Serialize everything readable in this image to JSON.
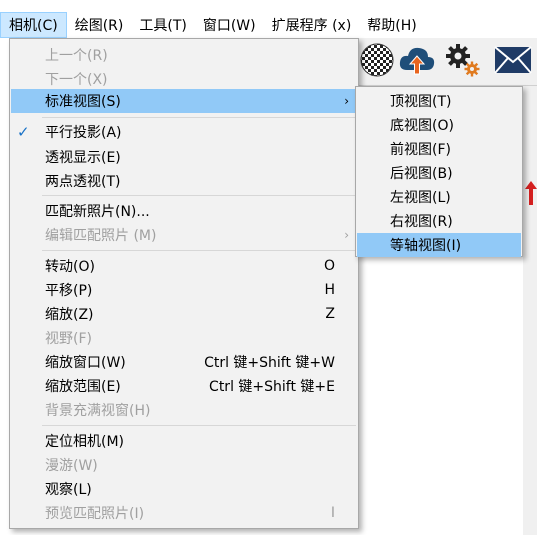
{
  "menubar": {
    "items": [
      {
        "label": "相机(C)",
        "active": true
      },
      {
        "label": "绘图(R)"
      },
      {
        "label": "工具(T)"
      },
      {
        "label": "窗口(W)"
      },
      {
        "label": "扩展程序 (x)"
      },
      {
        "label": "帮助(H)"
      }
    ]
  },
  "toolbar": {
    "icons": [
      "sphere-icon",
      "cloud-upload-icon",
      "gears-icon",
      "mail-icon"
    ]
  },
  "camera_menu": {
    "items": [
      {
        "label": "上一个(R)",
        "disabled": true
      },
      {
        "label": "下一个(X)",
        "disabled": true
      },
      {
        "label": "标准视图(S)",
        "submenu": true,
        "highlight": true
      },
      {
        "label": "平行投影(A)",
        "checked": true
      },
      {
        "label": "透视显示(E)"
      },
      {
        "label": "两点透视(T)"
      },
      {
        "label": "匹配新照片(N)..."
      },
      {
        "label": "编辑匹配照片 (M)",
        "disabled": true,
        "submenu": true
      },
      {
        "label": "转动(O)",
        "shortcut": "O"
      },
      {
        "label": "平移(P)",
        "shortcut": "H"
      },
      {
        "label": "缩放(Z)",
        "shortcut": "Z"
      },
      {
        "label": "视野(F)",
        "disabled": true
      },
      {
        "label": "缩放窗口(W)",
        "shortcut": "Ctrl 键+Shift 键+W"
      },
      {
        "label": "缩放范围(E)",
        "shortcut": "Ctrl 键+Shift 键+E"
      },
      {
        "label": "背景充满视窗(H)",
        "disabled": true
      },
      {
        "label": "定位相机(M)"
      },
      {
        "label": "漫游(W)",
        "disabled": true
      },
      {
        "label": "观察(L)"
      },
      {
        "label": "预览匹配照片(I)",
        "disabled": true,
        "shortcut": "I"
      }
    ]
  },
  "standard_views_submenu": {
    "items": [
      {
        "label": "顶视图(T)"
      },
      {
        "label": "底视图(O)"
      },
      {
        "label": "前视图(F)"
      },
      {
        "label": "后视图(B)"
      },
      {
        "label": "左视图(L)"
      },
      {
        "label": "右视图(R)"
      },
      {
        "label": "等轴视图(I)",
        "highlight": true
      }
    ]
  },
  "symbols": {
    "check": "✓",
    "arrow": "›"
  },
  "colors": {
    "highlight": "#91c9f7",
    "menubar_active": "#cce8ff",
    "disabled_text": "#a0a0a0",
    "check": "#1a73c7",
    "upload_arrow": "#e8641e",
    "gear_accent": "#e07a1f"
  }
}
